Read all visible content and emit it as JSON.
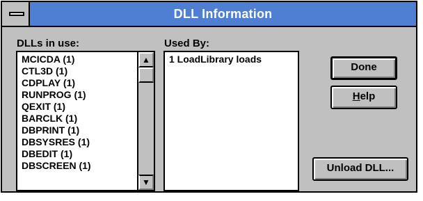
{
  "window": {
    "title": "DLL Information"
  },
  "dlls_list": {
    "label": "DLLs in use:",
    "items": [
      "MCICDA (1)",
      "CTL3D (1)",
      "CDPLAY (1)",
      "RUNPROG (1)",
      "QEXIT (1)",
      "BARCLK (1)",
      "DBPRINT (1)",
      "DBSYSRES (1)",
      "DBEDIT (1)",
      "DBSCREEN (1)"
    ],
    "scroll_up_glyph": "▲",
    "scroll_down_glyph": "▼"
  },
  "used_by": {
    "label": "Used By:",
    "items": [
      "1 LoadLibrary loads"
    ]
  },
  "buttons": {
    "done": "Done",
    "help_mnemonic": "H",
    "help_rest": "elp",
    "unload": "Unload DLL..."
  },
  "icons": {
    "system_menu": "system-menu-icon",
    "scroll_up": "arrow-up-icon",
    "scroll_down": "arrow-down-icon"
  },
  "colors": {
    "titlebar": "#4f7fd3",
    "dialog_bg": "#c0c0c0"
  }
}
